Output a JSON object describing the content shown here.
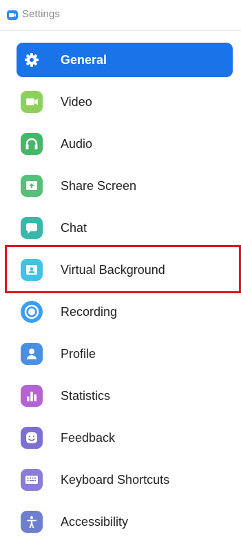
{
  "window": {
    "title": "Settings",
    "app_icon": "zoom-camera-icon",
    "accent_color": "#2d8cff"
  },
  "sidebar": {
    "selected_index": 0,
    "active_color": "#1a73e8",
    "items": [
      {
        "label": "General",
        "icon": "gear-icon",
        "color": "#ffffff"
      },
      {
        "label": "Video",
        "icon": "video-camera-icon",
        "color": "#8dd05b"
      },
      {
        "label": "Audio",
        "icon": "headphones-icon",
        "color": "#44b868"
      },
      {
        "label": "Share Screen",
        "icon": "share-screen-icon",
        "color": "#54c07a"
      },
      {
        "label": "Chat",
        "icon": "chat-bubble-icon",
        "color": "#38b8a8"
      },
      {
        "label": "Virtual Background",
        "icon": "virtual-background-icon",
        "color": "#41c3e3"
      },
      {
        "label": "Recording",
        "icon": "record-icon",
        "color": "#3e9ff0"
      },
      {
        "label": "Profile",
        "icon": "person-icon",
        "color": "#4a90e2"
      },
      {
        "label": "Statistics",
        "icon": "bar-chart-icon",
        "color": "#b563d4"
      },
      {
        "label": "Feedback",
        "icon": "smiley-icon",
        "color": "#7e6fd6"
      },
      {
        "label": "Keyboard Shortcuts",
        "icon": "keyboard-icon",
        "color": "#8b7bdb"
      },
      {
        "label": "Accessibility",
        "icon": "accessibility-icon",
        "color": "#6e7fd0"
      }
    ]
  },
  "annotation": {
    "highlighted_item": "Virtual Background",
    "color": "#e0141e"
  }
}
